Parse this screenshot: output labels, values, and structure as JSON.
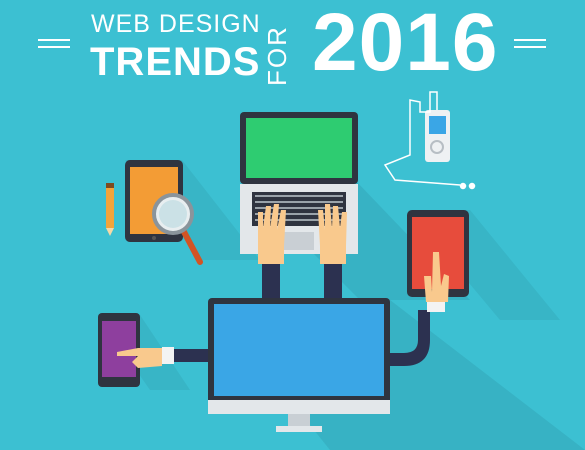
{
  "header": {
    "line1": "WEB DESIGN",
    "line2": "TRENDS",
    "rotated": "FOR",
    "year": "2016"
  },
  "colors": {
    "background": "#3cc0d2",
    "laptop_screen": "#2ecc71",
    "tablet_left_screen": "#f39c35",
    "tablet_right_screen": "#e74c3c",
    "phone_screen": "#8e3f9e",
    "monitor_screen": "#3aa6e6",
    "sleeve": "#2c3150",
    "skin": "#f9c98d"
  },
  "icons": [
    "pencil-icon",
    "magnifier-icon",
    "music-player-icon",
    "earphones-icon"
  ]
}
